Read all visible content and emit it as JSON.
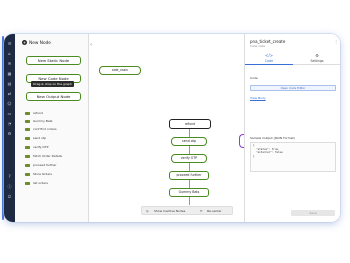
{
  "palette": {
    "title": "New Node",
    "add_icon": "plus-icon",
    "tooltip": "Drag & drop on the graph",
    "node_types": [
      "New Static Node",
      "New Code Node",
      "New Output Node"
    ],
    "items": [
      "refund",
      "Gummy Bats",
      "conf find orders",
      "send otp",
      "verify OTP",
      "Fetch Order Details",
      "proceed further",
      "Store Orders",
      "list orders"
    ]
  },
  "canvas": {
    "collapse_icon": "chevron-left-icon",
    "nodes": {
      "side": "side_vssiv",
      "refund": "refund",
      "send_otp": "send otp",
      "verify_otp": "verify OTP",
      "proceed": "proceed further",
      "gummy": "Gummy Bats"
    },
    "bottom_bar": {
      "show_inactive": "Show Inactive Nodes",
      "re_center": "Re-center"
    }
  },
  "inspector": {
    "title": "pna_ticket_create",
    "subtitle": "Code node",
    "tabs": [
      {
        "icon": "code-icon",
        "label": "Code"
      },
      {
        "icon": "gear-icon",
        "label": "Settings"
      }
    ],
    "code_label": "Code",
    "open_button": "Open Code Editor",
    "view_body_link": "View Body",
    "sample_label": "Sample Output (JSON Format)",
    "json_lines": [
      "{",
      "  \"status\": true,",
      "  \"external\": false",
      "}"
    ],
    "save_button": "Save"
  },
  "colors": {
    "rail": "#1e2a44",
    "node_border": "#4a8a1e",
    "accent": "#3b6fd6"
  }
}
